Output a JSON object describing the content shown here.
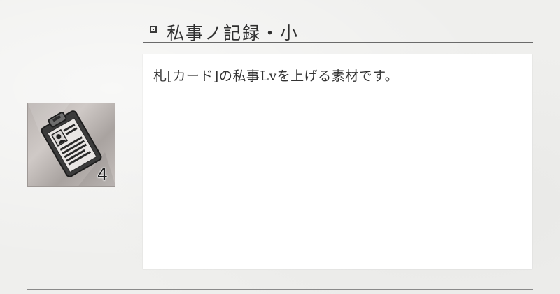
{
  "item": {
    "title": "私事ノ記録・小",
    "description": "札[カード]の私事Lvを上げる素材です。",
    "count": "4",
    "icon": "clipboard-icon"
  },
  "colors": {
    "background": "#efefed",
    "panel": "#ffffff",
    "text": "#333333"
  }
}
